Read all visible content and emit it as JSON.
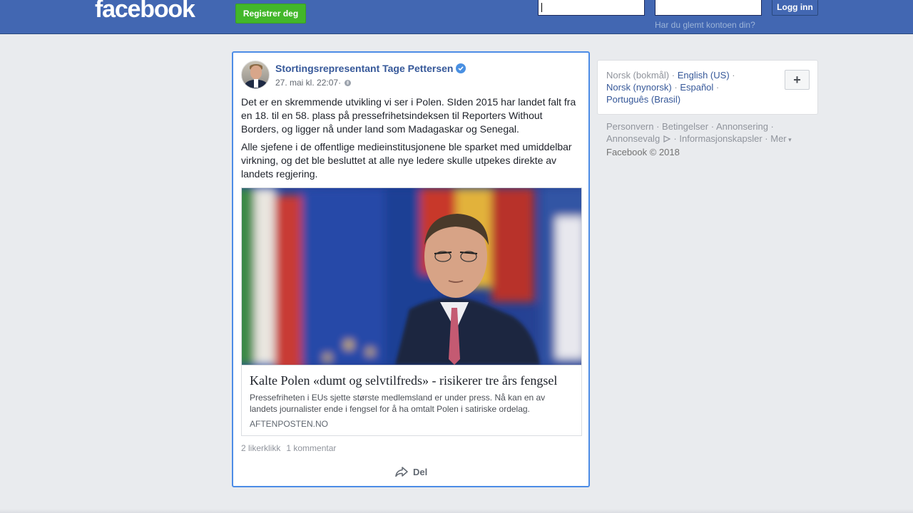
{
  "header": {
    "logo": "facebook",
    "register_label": "Registrer deg",
    "email_value": "",
    "password_value": "",
    "login_label": "Logg inn",
    "forgot_label": "Har du glemt kontoen din?",
    "brand_color": "#4267b2"
  },
  "post": {
    "author": "Stortingsrepresentant Tage Pettersen",
    "verified": true,
    "timestamp": "27. mai kl. 22:07",
    "meta_separator": " ·",
    "privacy_icon": "globe-icon",
    "paragraphs": [
      "Det er en skremmende utvikling vi ser i Polen. SIden 2015 har landet falt fra en 18. til en 58. plass på pressefrihetsindeksen til Reporters Without Borders, og ligger nå under land som Madagaskar og Senegal.",
      "Alle sjefene i de offentlige medieinstitusjonene ble sparket med umiddelbar virkning, og det ble besluttet at alle nye ledere skulle utpekes direkte av landets regjering."
    ],
    "link": {
      "title": "Kalte Polen «dumt og selvtilfreds» - risikerer tre års fengsel",
      "description": "Pressefriheten i EUs sjette største medlemsland er under press. Nå kan en av landets journalister ende i fengsel for å ha omtalt Polen i satiriske ordelag.",
      "domain": "AFTENPOSTEN.NO"
    },
    "likes": "2 likerklikk",
    "comments": "1 kommentar",
    "share_label": "Del"
  },
  "sidebar": {
    "languages": [
      {
        "label": "Norsk (bokmål)",
        "current": true
      },
      {
        "label": "English (US)",
        "current": false
      },
      {
        "label": "Norsk (nynorsk)",
        "current": false
      },
      {
        "label": "Español",
        "current": false
      },
      {
        "label": "Português (Brasil)",
        "current": false
      }
    ],
    "add_language_label": "+",
    "footer": {
      "personvern": "Personvern",
      "betingelser": "Betingelser",
      "annonsering": "Annonsering",
      "annonsevalg": "Annonsevalg",
      "informasjonskapsler": "Informasjonskapsler",
      "mer": "Mer",
      "copyright": "Facebook © 2018"
    }
  }
}
